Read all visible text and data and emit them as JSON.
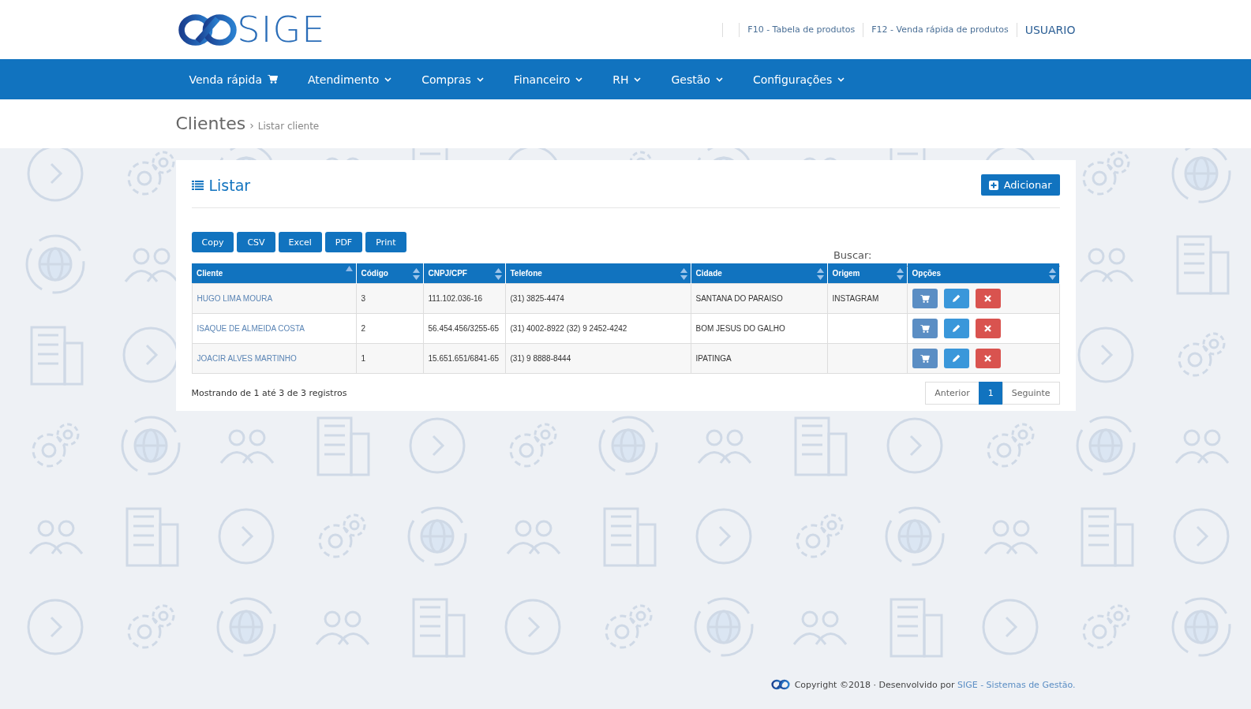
{
  "header": {
    "logo_text": "SIGE",
    "links": [
      "F10 - Tabela de produtos",
      "F12 - Venda rápida de produtos"
    ],
    "user": "USUARIO"
  },
  "nav": [
    {
      "label": "Venda rápida",
      "kind": "cart"
    },
    {
      "label": "Atendimento",
      "kind": "dropdown"
    },
    {
      "label": "Compras",
      "kind": "dropdown"
    },
    {
      "label": "Financeiro",
      "kind": "dropdown"
    },
    {
      "label": "RH",
      "kind": "dropdown"
    },
    {
      "label": "Gestão",
      "kind": "dropdown"
    },
    {
      "label": "Configurações",
      "kind": "dropdown"
    }
  ],
  "breadcrumb": {
    "title": "Clientes",
    "separator": "›",
    "current": "Listar cliente"
  },
  "panel": {
    "title": "Listar",
    "add_button": "Adicionar",
    "export_buttons": [
      "Copy",
      "CSV",
      "Excel",
      "PDF",
      "Print"
    ],
    "search": {
      "label": "Buscar:"
    },
    "table": {
      "columns": [
        {
          "label": "Cliente",
          "sorted_ascending": true
        },
        {
          "label": "Código",
          "sorted_ascending": false
        },
        {
          "label": "CNPJ/CPF",
          "sorted_ascending": false
        },
        {
          "label": "Telefone",
          "sorted_ascending": false
        },
        {
          "label": "Cidade",
          "sorted_ascending": false
        },
        {
          "label": "Origem",
          "sorted_ascending": false
        },
        {
          "label": "Opções",
          "sorted_ascending": false
        }
      ],
      "rows": [
        {
          "cliente": "HUGO LIMA MOURA",
          "codigo": "3",
          "cnpj_cpf": "111.102.036-16",
          "telefone": "(31) 3825-4474",
          "cidade": "SANTANA DO PARAISO",
          "origem": "INSTAGRAM"
        },
        {
          "cliente": "ISAQUE DE ALMEIDA COSTA",
          "codigo": "2",
          "cnpj_cpf": "56.454.456/3255-65",
          "telefone": "(31) 4002-8922 (32) 9 2452-4242",
          "cidade": "BOM JESUS DO GALHO"
        },
        {
          "cliente": "JOACIR ALVES MARTINHO",
          "codigo": "1",
          "cnpj_cpf": "15.651.651/6841-65",
          "telefone": "(31) 9 8888-8444",
          "cidade": "IPATINGA"
        }
      ]
    },
    "info": "Mostrando de 1 até 3 de 3 registros",
    "pagination": [
      {
        "label": "Anterior",
        "selected": false
      },
      {
        "label": "1",
        "selected": true
      },
      {
        "label": "Seguinte",
        "selected": false
      }
    ]
  },
  "footer": {
    "text": "Copyright ©2018 · Desenvolvido por",
    "link": "SIGE - Sistemas de Gestão."
  }
}
